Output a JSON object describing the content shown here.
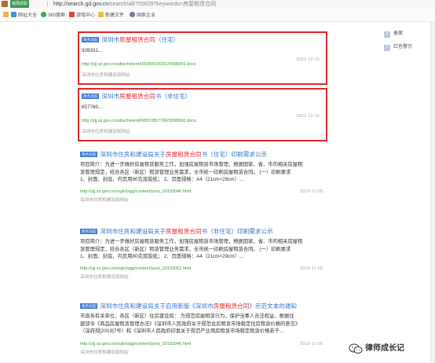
{
  "browser": {
    "trust_badge": "我再抓取",
    "url_host": "http://search.gd.gov.cn",
    "url_path": "/search/all/755029?keywords=房屋租赁合同"
  },
  "bookmarks": [
    {
      "label": "网址大全",
      "color": "#4a8fd8"
    },
    {
      "label": "360搜索",
      "color": "#3aa655"
    },
    {
      "label": "游戏中心",
      "color": "#e04a3a"
    },
    {
      "label": "新建文件",
      "color": "#f0c040"
    },
    {
      "label": "国家企业",
      "color": "#6f7fa0"
    }
  ],
  "results": [
    {
      "tag": "政务动态",
      "title_pre": "深圳市",
      "title_hl": "房屋租赁合同",
      "title_post": "（住宅）",
      "snippet": [
        "928331..."
      ],
      "link": "http://zjj.sz.gov.cn/attachment/0/928/928331/9998059.docx",
      "date": "2021-12-15",
      "site": "深圳市住房和建设局网站"
    },
    {
      "tag": "政务动态",
      "title_pre": "深圳市",
      "title_hl": "房屋租赁合同",
      "title_post": "书（非住宅）",
      "snippet": [
        "857760..."
      ],
      "link": "http://zjj.sz.gov.cn/attachment/0/857/857760/9998060.docx",
      "date": "2021-12-15",
      "site": "深圳市住房和建设局网站"
    },
    {
      "tag": "政务动态",
      "title_pre": "深圳市住房和建设局关于",
      "title_hl": "房屋租赁合同",
      "title_post": "书（住宅）印刷需求公示",
      "snippet": [
        "项目简介：为进一步做好房屋租赁服务工作，加强房屋租赁市场管理，根据国家、省、市的相关房屋租",
        "赁管理规定，结合各区（新区）租赁管理业务需求，全市统一印刷房屋租赁合同。      (一）印刷要求",
        "     1、封面、封底、内页用80克双胶纸；      2、页面规格：A4（21cm×29cm）..."
      ],
      "link": "http://zjj.sz.gov.cn/xxgk/tzgg/content/post_10193046.html",
      "date": "2019-11-05",
      "site": "深圳市住房和建设局网站"
    },
    {
      "tag": "政务动态",
      "title_pre": "深圳市住房和建设局关于",
      "title_hl": "房屋租赁合同",
      "title_post": "书（非住宅）印刷需求公示",
      "snippet": [
        "项目简介：为进一步做好房屋租赁服务工作，加强房屋租赁市场管理，根据国家、省、市的相关房屋租",
        "赁管理规定，结合各区（新区）租赁管理业务需求，全市统一印刷房屋租赁合同。      (一）印刷要求",
        "     1、封面、封底、内页用80克双胶纸；      2、页面规格：A4（21cm×29cm）..."
      ],
      "link": "http://zjj.sz.gov.cn/xxgk/tzgg/content/post_10193052.html",
      "date": "2019-11-05",
      "site": "深圳市住房和建设局网站"
    },
    {
      "tag": "政务动态",
      "title_pre": "深圳市住房和建设局关于启用新版《深圳市",
      "title_hl": "房屋租赁合同",
      "title_post": "》示范文本的通知",
      "snippet": [
        "市直各有关单位，各区（新区）住房建设局：      为规范房屋租赁行为，保护当事人合法权益，根据住",
        "建部令《商品房屋租赁管理办法》《深圳市人民政府关于规范住房租赁市场稳定住房租赁价格的意见》",
        "（深府规[2019]7号）和《深圳市人民政府印发关于规范产业用房租赁市场稳定租赁价格若干..."
      ],
      "link": "http://zjj.sz.gov.cn/xxgk/tzgg/content/post_10193040.html",
      "date": "2019-11-05",
      "site": "深圳市住房和建设局网站"
    }
  ],
  "sidebar": [
    {
      "icon": "7",
      "label": "备案"
    },
    {
      "icon": "7",
      "label": "红色警示"
    }
  ],
  "watermark": {
    "text": "律师成长记"
  },
  "colors": {
    "link_title": "#3274c8",
    "highlight": "#e0282f",
    "url_green": "#3a9a3a",
    "tag_blue": "#3b7bd6"
  }
}
